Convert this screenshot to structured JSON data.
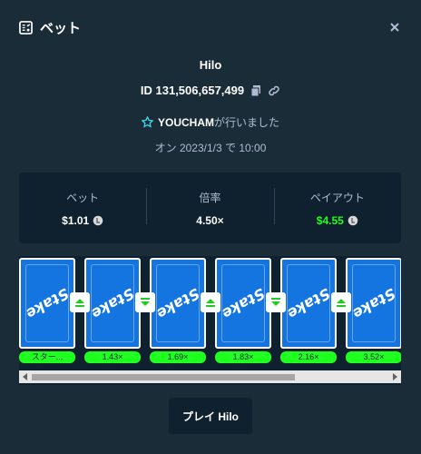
{
  "header": {
    "title": "ベット",
    "icon": "bet-slip-icon",
    "close_icon": "close-icon"
  },
  "game": {
    "name": "Hilo"
  },
  "bet": {
    "id": "ID 131,506,657,499"
  },
  "player": {
    "name": "YOUCHAM",
    "suffix": "が行いました",
    "date": "オン 2023/1/3 で 10:00"
  },
  "stats": {
    "bet_label": "ベット",
    "bet_value": "$1.01",
    "multiplier_label": "倍率",
    "multiplier_value": "4.50×",
    "payout_label": "ペイアウト",
    "payout_value": "$4.55"
  },
  "cards": [
    {
      "multiplier": "スター...",
      "logo": "Stake"
    },
    {
      "multiplier": "1.43×",
      "logo": "Stake"
    },
    {
      "multiplier": "1.69×",
      "logo": "Stake"
    },
    {
      "multiplier": "1.83×",
      "logo": "Stake"
    },
    {
      "multiplier": "2.16×",
      "logo": "Stake"
    },
    {
      "multiplier": "3.52×",
      "logo": "Stake"
    }
  ],
  "guesses": [
    "higher",
    "lower",
    "higher",
    "lower",
    "higher"
  ],
  "play_button": {
    "label": "プレイ Hilo"
  },
  "colors": {
    "bg": "#1a2c38",
    "panel": "#0f212e",
    "card": "#1475e1",
    "green": "#1fff20"
  }
}
